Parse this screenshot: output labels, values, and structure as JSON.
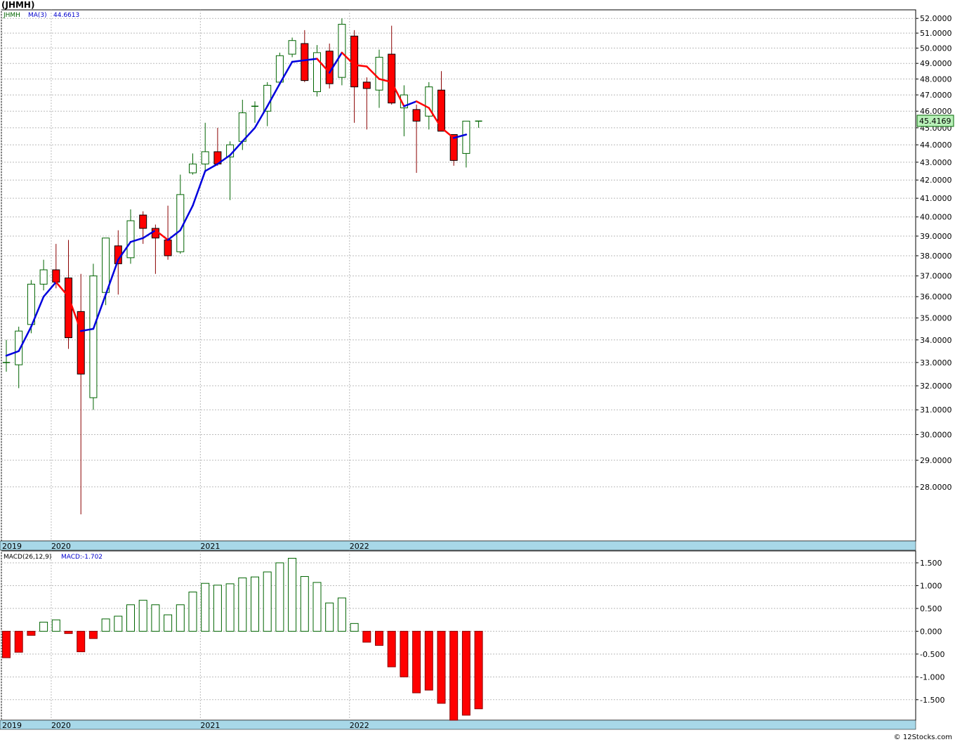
{
  "title": "(JHMH)",
  "footer": "© 12Stocks.com",
  "price_panel": {
    "legend_symbol": "JHMH",
    "legend_ma": "MA(3)",
    "legend_ma_value": "44.6613",
    "last_price_label": "45.4169",
    "y_ticks": [
      "52.0000",
      "51.0000",
      "50.0000",
      "49.0000",
      "48.0000",
      "47.0000",
      "46.0000",
      "45.0000",
      "44.0000",
      "43.0000",
      "42.0000",
      "41.0000",
      "40.0000",
      "39.0000",
      "38.0000",
      "37.0000",
      "36.0000",
      "35.0000",
      "34.0000",
      "33.0000",
      "32.0000",
      "31.0000",
      "30.0000",
      "29.0000",
      "28.0000"
    ]
  },
  "macd_panel": {
    "legend_label": "MACD(26,12,9)",
    "legend_value": "MACD:-1.702",
    "y_ticks": [
      "1.500",
      "1.000",
      "0.500",
      "0.000",
      "-0.500",
      "-1.000",
      "-1.500"
    ]
  },
  "x_axis": {
    "year_labels": [
      "2019",
      "2020",
      "2021",
      "2022"
    ]
  },
  "colors": {
    "up_candle_border": "#006400",
    "down_candle_fill": "#ff0000",
    "ma_up": "#0000dd",
    "ma_down": "#ff0000",
    "axis_band": "#a8d8e8",
    "last_price_bg": "#b8f0b8",
    "grid": "#bbbbbb"
  },
  "chart_data": [
    {
      "type": "candlestick",
      "symbol": "JHMH",
      "interval": "monthly",
      "ylim": [
        27,
        52.3
      ],
      "candles": [
        {
          "date": "2019-12",
          "open": 33.0,
          "high": 34.0,
          "low": 32.6,
          "close": 33.0
        },
        {
          "date": "2020-01",
          "open": 32.9,
          "high": 34.6,
          "low": 31.9,
          "close": 34.4
        },
        {
          "date": "2020-02",
          "open": 34.7,
          "high": 36.8,
          "low": 34.3,
          "close": 36.6
        },
        {
          "date": "2020-03",
          "open": 36.6,
          "high": 37.8,
          "low": 36.3,
          "close": 37.3
        },
        {
          "date": "2020-04",
          "open": 37.3,
          "high": 38.6,
          "low": 36.4,
          "close": 36.7
        },
        {
          "date": "2020-05",
          "open": 36.9,
          "high": 38.8,
          "low": 33.6,
          "close": 34.1
        },
        {
          "date": "2020-06",
          "open": 35.3,
          "high": 37.1,
          "low": 27.0,
          "close": 32.5
        },
        {
          "date": "2020-07",
          "open": 31.5,
          "high": 37.6,
          "low": 31.0,
          "close": 37.0
        },
        {
          "date": "2020-08",
          "open": 36.2,
          "high": 38.9,
          "low": 35.6,
          "close": 38.9
        },
        {
          "date": "2020-09",
          "open": 38.5,
          "high": 39.3,
          "low": 36.1,
          "close": 37.6
        },
        {
          "date": "2020-10",
          "open": 37.9,
          "high": 40.4,
          "low": 37.6,
          "close": 39.8
        },
        {
          "date": "2020-11",
          "open": 40.1,
          "high": 40.3,
          "low": 38.6,
          "close": 39.4
        },
        {
          "date": "2020-12",
          "open": 39.4,
          "high": 39.6,
          "low": 37.1,
          "close": 38.9
        },
        {
          "date": "2021-01",
          "open": 38.8,
          "high": 40.6,
          "low": 37.8,
          "close": 38.0
        },
        {
          "date": "2021-02",
          "open": 38.2,
          "high": 42.3,
          "low": 38.1,
          "close": 41.2
        },
        {
          "date": "2021-03",
          "open": 42.4,
          "high": 43.5,
          "low": 42.3,
          "close": 42.9
        },
        {
          "date": "2021-04",
          "open": 42.9,
          "high": 45.3,
          "low": 42.5,
          "close": 43.6
        },
        {
          "date": "2021-05",
          "open": 43.6,
          "high": 45.0,
          "low": 42.8,
          "close": 42.9
        },
        {
          "date": "2021-06",
          "open": 43.3,
          "high": 44.2,
          "low": 40.9,
          "close": 44.0
        },
        {
          "date": "2021-07",
          "open": 44.2,
          "high": 46.7,
          "low": 43.7,
          "close": 45.9
        },
        {
          "date": "2021-08",
          "open": 46.3,
          "high": 46.6,
          "low": 45.3,
          "close": 46.3
        },
        {
          "date": "2021-09",
          "open": 46.0,
          "high": 47.8,
          "low": 45.1,
          "close": 47.6
        },
        {
          "date": "2021-10",
          "open": 47.8,
          "high": 49.7,
          "low": 47.6,
          "close": 49.5
        },
        {
          "date": "2021-11",
          "open": 49.6,
          "high": 50.7,
          "low": 49.4,
          "close": 50.5
        },
        {
          "date": "2021-12",
          "open": 50.3,
          "high": 51.2,
          "low": 47.8,
          "close": 47.9
        },
        {
          "date": "2022-01",
          "open": 47.2,
          "high": 50.2,
          "low": 46.9,
          "close": 49.7
        },
        {
          "date": "2022-02",
          "open": 49.8,
          "high": 50.3,
          "low": 47.4,
          "close": 47.7
        },
        {
          "date": "2022-03",
          "open": 48.1,
          "high": 52.0,
          "low": 47.6,
          "close": 51.6
        },
        {
          "date": "2022-04",
          "open": 50.8,
          "high": 51.2,
          "low": 45.3,
          "close": 47.5
        },
        {
          "date": "2022-05",
          "open": 47.8,
          "high": 48.1,
          "low": 44.9,
          "close": 47.4
        },
        {
          "date": "2022-06",
          "open": 47.3,
          "high": 49.9,
          "low": 46.2,
          "close": 49.4
        },
        {
          "date": "2022-07",
          "open": 49.6,
          "high": 51.5,
          "low": 46.4,
          "close": 46.5
        },
        {
          "date": "2022-08",
          "open": 46.2,
          "high": 47.6,
          "low": 44.5,
          "close": 47.0
        },
        {
          "date": "2022-09",
          "open": 46.1,
          "high": 46.4,
          "low": 42.4,
          "close": 45.4
        },
        {
          "date": "2022-10",
          "open": 45.7,
          "high": 47.8,
          "low": 44.9,
          "close": 47.5
        },
        {
          "date": "2022-11",
          "open": 47.3,
          "high": 48.5,
          "low": 44.8,
          "close": 44.8
        },
        {
          "date": "2022-12",
          "open": 44.6,
          "high": 44.6,
          "low": 42.8,
          "close": 43.1
        },
        {
          "date": "2023-01",
          "open": 43.5,
          "high": 45.4,
          "low": 42.7,
          "close": 45.4
        },
        {
          "date": "2023-02",
          "open": 45.4,
          "high": 45.4,
          "low": 45.0,
          "close": 45.4
        }
      ],
      "ma3": [
        33.3,
        33.5,
        34.6,
        36.0,
        36.7,
        36.0,
        34.4,
        34.5,
        36.1,
        37.8,
        38.7,
        38.9,
        39.3,
        38.8,
        39.3,
        40.6,
        42.5,
        42.9,
        43.4,
        44.2,
        45.0,
        46.3,
        47.7,
        49.1,
        49.2,
        49.3,
        48.4,
        49.7,
        48.9,
        48.8,
        48.0,
        47.8,
        46.3,
        46.6,
        46.2,
        45.0,
        44.4,
        44.6
      ]
    },
    {
      "type": "bar",
      "title": "MACD(26,12,9)",
      "ylim": [
        -1.95,
        1.7
      ],
      "values": [
        -0.58,
        -0.46,
        -0.09,
        0.2,
        0.25,
        -0.05,
        -0.45,
        -0.16,
        0.27,
        0.33,
        0.58,
        0.68,
        0.58,
        0.36,
        0.58,
        0.86,
        1.05,
        1.01,
        1.04,
        1.17,
        1.19,
        1.3,
        1.5,
        1.6,
        1.2,
        1.07,
        0.62,
        0.73,
        0.17,
        -0.24,
        -0.31,
        -0.78,
        -1.0,
        -1.35,
        -1.29,
        -1.58,
        -1.95,
        -1.84,
        -1.7
      ]
    }
  ]
}
